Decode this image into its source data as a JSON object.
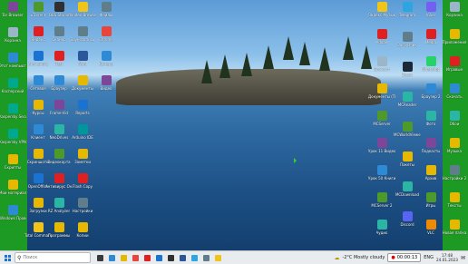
{
  "desktop": {
    "left_column": [
      {
        "label": "Tor Browser",
        "icon": "tor-browser-icon",
        "color": "#7d4698"
      },
      {
        "label": "Корзина",
        "icon": "recycle-bin-icon",
        "color": "#9bb6c9"
      },
      {
        "label": "Этот компьютер",
        "icon": "this-pc-icon",
        "color": "#2f8ad6"
      },
      {
        "label": "Касперский",
        "icon": "kaspersky-icon",
        "color": "#00a88e"
      },
      {
        "label": "Kaspersky Secure",
        "icon": "kaspersky-secure-icon",
        "color": "#00a88e"
      },
      {
        "label": "Kaspersky VPN",
        "icon": "kaspersky-vpn-icon",
        "color": "#00a88e"
      },
      {
        "label": "Скрипты",
        "icon": "scripts-icon",
        "color": "#e6b800"
      },
      {
        "label": "Мои материалы",
        "icon": "folder-icon",
        "color": "#e6b800"
      },
      {
        "label": "Windows Проверки",
        "icon": "windows-check-icon",
        "color": "#2f8ad6"
      }
    ],
    "col2": [
      {
        "label": "uTorrent",
        "icon": "utorrent-icon",
        "color": "#4d9a2b"
      },
      {
        "label": "Яндекс",
        "icon": "yandex-icon",
        "color": "#e02020"
      },
      {
        "label": "Антивирус",
        "icon": "antivirus-icon",
        "color": "#1a73d0"
      },
      {
        "label": "Сетевое",
        "icon": "network-icon",
        "color": "#2f8ad6"
      },
      {
        "label": "Курсы",
        "icon": "courses-icon",
        "color": "#e6b800"
      },
      {
        "label": "Клиент",
        "icon": "client-icon",
        "color": "#2f8ad6"
      },
      {
        "label": "Скриншоты",
        "icon": "screenshots-icon",
        "color": "#e6b800"
      },
      {
        "label": "OpenOffice",
        "icon": "openoffice-icon",
        "color": "#1a73d0"
      },
      {
        "label": "Загрузки",
        "icon": "downloads-icon",
        "color": "#e6b800"
      },
      {
        "label": "Total Commander",
        "icon": "total-commander-icon",
        "color": "#f0c419"
      }
    ],
    "col3": [
      {
        "label": "OBS Studio",
        "icon": "obs-icon",
        "color": "#303030"
      },
      {
        "label": "Сканер",
        "icon": "scanner-icon",
        "color": "#607d8b"
      },
      {
        "label": "Flash",
        "icon": "flash-icon",
        "color": "#e02020"
      },
      {
        "label": "Браузер",
        "icon": "browser-icon",
        "color": "#2f8ad6"
      },
      {
        "label": "Frame-Vid",
        "icon": "video-icon",
        "color": "#7d4698"
      },
      {
        "label": "NeoDrives",
        "icon": "neodrives-icon",
        "color": "#2bb5a4"
      },
      {
        "label": "Видеокарта",
        "icon": "gpu-icon",
        "color": "#4d9a2b"
      },
      {
        "label": "Антивирус Онлайн",
        "icon": "antivirus-online-icon",
        "color": "#e02020"
      },
      {
        "label": "RZ Analyzer",
        "icon": "analyzer-icon",
        "color": "#2bb5a4"
      },
      {
        "label": "Программы",
        "icon": "programs-icon",
        "color": "#e6b800"
      }
    ],
    "col4": [
      {
        "label": "Yandex Browser",
        "icon": "yandex-browser-icon",
        "color": "#f0c419"
      },
      {
        "label": "Звукозапись",
        "icon": "recorder-icon",
        "color": "#607d8b"
      },
      {
        "label": "Word",
        "icon": "word-icon",
        "color": "#2b579a"
      },
      {
        "label": "Документы",
        "icon": "documents-icon",
        "color": "#e6b800"
      },
      {
        "label": "Reports",
        "icon": "reports-icon",
        "color": "#1a73d0"
      },
      {
        "label": "Arduino IDE",
        "icon": "arduino-icon",
        "color": "#00979c"
      },
      {
        "label": "Заметки",
        "icon": "notes-icon",
        "color": "#e6b800"
      },
      {
        "label": "Flash Copy",
        "icon": "flash-copy-icon",
        "color": "#e02020"
      },
      {
        "label": "Настройки",
        "icon": "settings-icon",
        "color": "#607d8b"
      },
      {
        "label": "Копии",
        "icon": "copies-icon",
        "color": "#e6b800"
      }
    ],
    "col5": [
      {
        "label": "Файлы",
        "icon": "file-icon",
        "color": "#607d8b"
      },
      {
        "label": "Chrome",
        "icon": "chrome-icon",
        "color": "#e8453c"
      },
      {
        "label": "Камера",
        "icon": "camera-icon",
        "color": "#2f8ad6"
      },
      {
        "label": "Видео",
        "icon": "video-file-icon",
        "color": "#7d4698"
      }
    ],
    "right_inner_column": [
      {
        "label": "Яндекс Музыка",
        "icon": "music-icon",
        "color": "#f0c419"
      },
      {
        "label": "Adobe",
        "icon": "adobe-icon",
        "color": "#e02020"
      },
      {
        "label": "Блокнот",
        "icon": "notepad-icon",
        "color": "#9bb6c9"
      },
      {
        "label": "Документы (ТВ)",
        "icon": "docs-tv-icon",
        "color": "#e6b800"
      },
      {
        "label": "MCServer",
        "icon": "mcserver-icon",
        "color": "#4d9a2b"
      },
      {
        "label": "Урок 11 Видео",
        "icon": "lesson-video-icon",
        "color": "#7d4698"
      },
      {
        "label": "Урок 50 Книги",
        "icon": "lesson-books-icon",
        "color": "#2f8ad6"
      },
      {
        "label": "MCServer 2",
        "icon": "mcserver2-icon",
        "color": "#4d9a2b"
      },
      {
        "label": "Аудио",
        "icon": "audio-icon",
        "color": "#2bb5a4"
      }
    ],
    "right_col2": [
      {
        "label": "Telegram",
        "icon": "telegram-icon",
        "color": "#2ca5e0"
      },
      {
        "label": "Загрузчик",
        "icon": "downloader-icon",
        "color": "#607d8b"
      },
      {
        "label": "Steam",
        "icon": "steam-icon",
        "color": "#1b2838"
      },
      {
        "label": "MCReader",
        "icon": "mcreader-icon",
        "color": "#2bb5a4"
      },
      {
        "label": "MCWorldViewer",
        "icon": "mcworld-icon",
        "color": "#4d9a2b"
      },
      {
        "label": "Пакеты",
        "icon": "packages-icon",
        "color": "#e6b800"
      },
      {
        "label": "MCDownload",
        "icon": "mcdownload-icon",
        "color": "#2bb5a4"
      },
      {
        "label": "Discord",
        "icon": "discord-icon",
        "color": "#5865f2"
      }
    ],
    "right_col3": [
      {
        "label": "Viber",
        "icon": "viber-icon",
        "color": "#7360f2"
      },
      {
        "label": "Media",
        "icon": "media-icon",
        "color": "#e02020"
      },
      {
        "label": "WhatsApp",
        "icon": "whatsapp-icon",
        "color": "#25d366"
      },
      {
        "label": "Браузер 2",
        "icon": "browser2-icon",
        "color": "#2f8ad6"
      },
      {
        "label": "Фото",
        "icon": "photos-icon",
        "color": "#2bb5a4"
      },
      {
        "label": "Подкасты",
        "icon": "podcasts-icon",
        "color": "#7d4698"
      },
      {
        "label": "Архив",
        "icon": "archive-icon",
        "color": "#e6b800"
      },
      {
        "label": "Игры",
        "icon": "games-icon",
        "color": "#4d9a2b"
      },
      {
        "label": "VLC",
        "icon": "vlc-icon",
        "color": "#f08a00"
      }
    ],
    "far_right_column": [
      {
        "label": "Корзина",
        "icon": "bin-icon",
        "color": "#9bb6c9"
      },
      {
        "label": "Приложения",
        "icon": "apps-icon",
        "color": "#e6b800"
      },
      {
        "label": "Игровые",
        "icon": "gaming-icon",
        "color": "#e02020"
      },
      {
        "label": "Скачать",
        "icon": "download-icon",
        "color": "#2f8ad6"
      },
      {
        "label": "Обои",
        "icon": "wallpaper-icon",
        "color": "#2bb5a4"
      },
      {
        "label": "Музыка",
        "icon": "music-folder-icon",
        "color": "#e6b800"
      },
      {
        "label": "Настройки 2",
        "icon": "settings2-icon",
        "color": "#607d8b"
      },
      {
        "label": "Тексты",
        "icon": "texts-icon",
        "color": "#e6b800"
      },
      {
        "label": "Новая папка",
        "icon": "new-folder-icon",
        "color": "#e6b800"
      }
    ]
  },
  "taskbar": {
    "search_placeholder": "Поиск",
    "apps": [
      {
        "name": "task-view",
        "color": "#3a3a3a"
      },
      {
        "name": "edge",
        "color": "#2f8ad6"
      },
      {
        "name": "explorer",
        "color": "#e6b800"
      },
      {
        "name": "chrome",
        "color": "#e8453c"
      },
      {
        "name": "yandex",
        "color": "#e02020"
      },
      {
        "name": "store",
        "color": "#1a73d0"
      },
      {
        "name": "obs",
        "color": "#303030"
      },
      {
        "name": "word",
        "color": "#2b579a"
      },
      {
        "name": "telegram",
        "color": "#2ca5e0"
      },
      {
        "name": "settings",
        "color": "#607d8b"
      },
      {
        "name": "yandex-browser",
        "color": "#f0c419"
      }
    ],
    "weather": "-2°C  Mostly cloudy",
    "timer": "00:00:13",
    "language": "ENG",
    "time": "17:48",
    "date": "24.01.2023"
  }
}
